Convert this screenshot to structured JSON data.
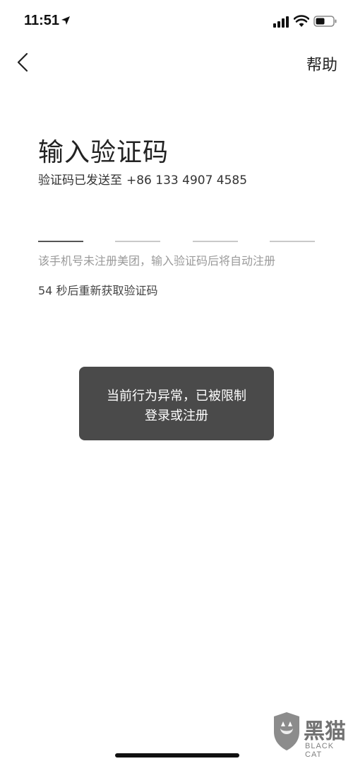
{
  "status_bar": {
    "time": "11:51"
  },
  "nav": {
    "help_label": "帮助"
  },
  "page": {
    "title": "输入验证码",
    "sent_to_label": "验证码已发送至",
    "phone": "+86 133 4907 4585",
    "hint": "该手机号未注册美团，输入验证码后将自动注册",
    "countdown": "54 秒后重新获取验证码"
  },
  "toast": {
    "line1": "当前行为异常，已被限制",
    "line2": "登录或注册"
  },
  "watermark": {
    "brand": "黑猫",
    "sub": "BLACK CAT"
  },
  "colors": {
    "toast_bg": "#4a4a4a",
    "hint": "#9a9a9a",
    "text": "#222222"
  }
}
